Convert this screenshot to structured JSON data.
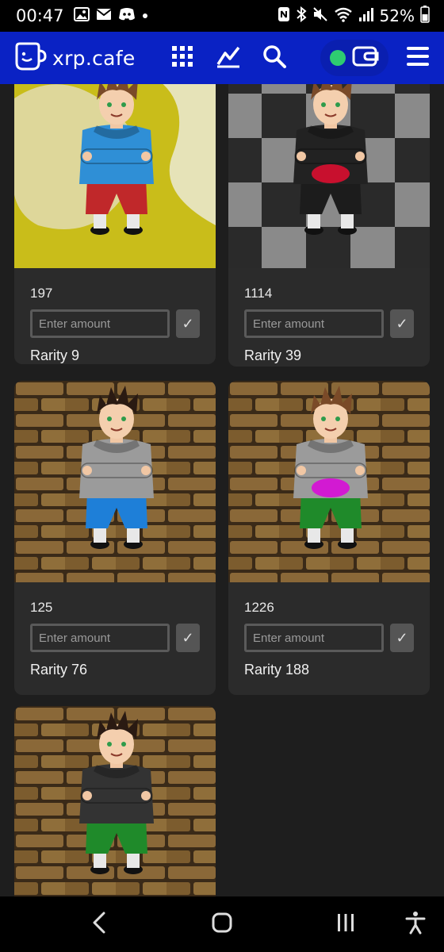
{
  "status_bar": {
    "time": "00:47",
    "battery": "52%",
    "left_icons": [
      "photo-icon",
      "gmail-icon",
      "discord-icon",
      "dot-icon"
    ],
    "right_icons": [
      "nfc-icon",
      "bluetooth-icon",
      "mute-icon",
      "wifi-icon",
      "signal-icon",
      "battery-icon"
    ]
  },
  "header": {
    "brand": "xrp.cafe",
    "nav_icons": [
      "grid-icon",
      "chart-icon",
      "search-icon"
    ],
    "wallet_connected": true,
    "accent_color": "#0a22c4",
    "status_color": "#2ecc71"
  },
  "cards": [
    {
      "id": "197",
      "placeholder": "Enter amount",
      "confirm": "✓",
      "rarity": "Rarity 9",
      "background": "yellow-swirl",
      "hoodie": "#2f8fd6",
      "pants": "#c0282a",
      "hair": "#7a4a28"
    },
    {
      "id": "1114",
      "placeholder": "Enter amount",
      "confirm": "✓",
      "rarity": "Rarity 39",
      "background": "checker",
      "hoodie": "#222222",
      "pants": "#222222",
      "hair": "#7a4a28"
    },
    {
      "id": "125",
      "placeholder": "Enter amount",
      "confirm": "✓",
      "rarity": "Rarity 76",
      "background": "brick",
      "hoodie": "#9b9b9b",
      "pants": "#1e7fd8",
      "hair": "#2a1a12"
    },
    {
      "id": "1226",
      "placeholder": "Enter amount",
      "confirm": "✓",
      "rarity": "Rarity 188",
      "background": "brick",
      "hoodie": "#9b9b9b",
      "pants": "#1f8a2a",
      "hair": "#7a4a28"
    },
    {
      "id": "",
      "placeholder": "",
      "confirm": "",
      "rarity": "",
      "background": "brick",
      "hoodie": "#333333",
      "pants": "#1f8a2a",
      "hair": "#2a1a12"
    }
  ],
  "bottom_nav": [
    "back-icon",
    "home-icon",
    "recents-icon",
    "accessibility-icon"
  ]
}
